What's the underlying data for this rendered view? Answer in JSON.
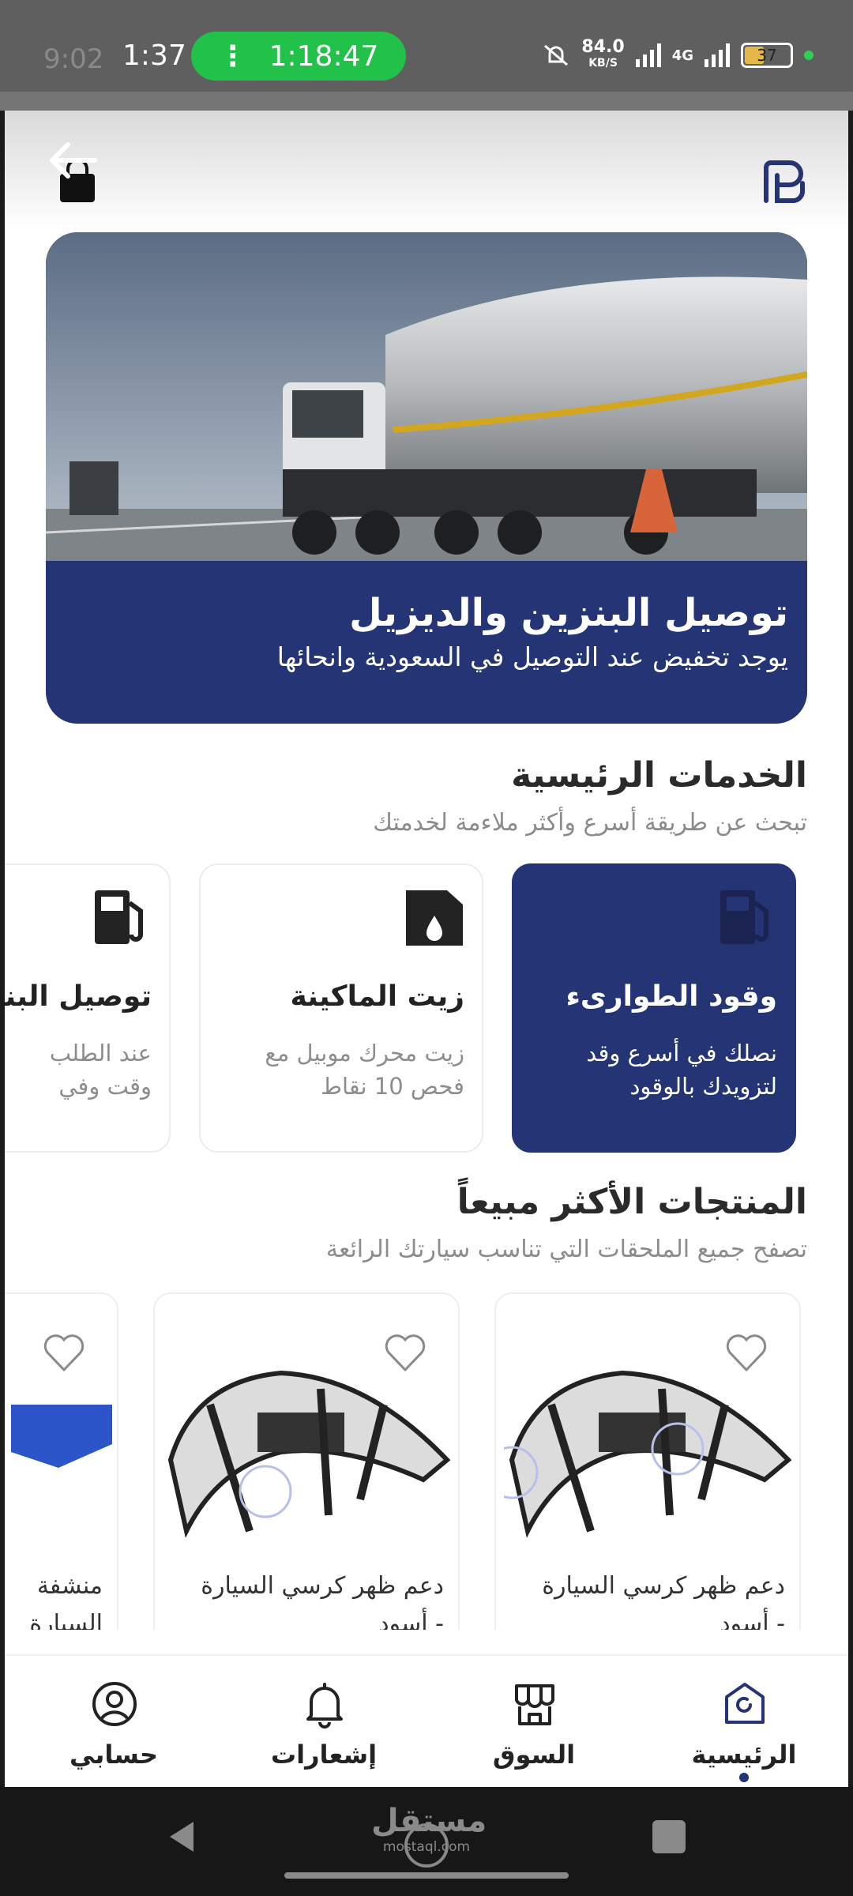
{
  "status_bar": {
    "ghost_time": "9:02",
    "time": "1:37",
    "call_dot": "⋮",
    "call_timer": "1:18:47",
    "net_speed": "84.0",
    "net_speed_unit": "KB/S",
    "network_type": "4G",
    "battery": "37"
  },
  "banner": {
    "title": "توصيل البنزين والديزيل",
    "subtitle": "يوجد تخفيض عند التوصيل في السعودية وانحائها"
  },
  "services_section": {
    "title": "الخدمات الرئيسية",
    "subtitle": "تبحث عن طريقة أسرع وأكثر ملاءمة لخدمتك",
    "items": [
      {
        "title": "وقود الطوارىء",
        "desc": "نصلك في أسرع وقد\nلتزويدك بالوقود",
        "icon": "fuel-pump-icon",
        "active": true
      },
      {
        "title": "زيت الماكينة",
        "desc": "زيت محرك موبيل مع\nفحص 10 نقاط",
        "icon": "oil-can-icon",
        "active": false
      },
      {
        "title": "توصيل البنزين",
        "desc": "عند الطلب\nوقت وفي",
        "icon": "fuel-pump-icon",
        "active": false
      }
    ]
  },
  "products_section": {
    "title": "المنتجات الأكثر مبيعاً",
    "subtitle": "تصفح جميع الملحقات التي تناسب سيارتك الرائعة",
    "items": [
      {
        "name": "دعم ظهر كرسي السيارة",
        "name2": "- أسود"
      },
      {
        "name": "دعم ظهر كرسي السيارة",
        "name2": "- أسود"
      },
      {
        "name": "منشفة",
        "name2": "السيارة"
      }
    ]
  },
  "bottom_nav": {
    "items": [
      {
        "label": "الرئيسية",
        "icon": "home-icon",
        "active": true
      },
      {
        "label": "السوق",
        "icon": "store-icon",
        "active": false
      },
      {
        "label": "إشعارات",
        "icon": "bell-icon",
        "active": false
      },
      {
        "label": "حسابي",
        "icon": "user-icon",
        "active": false
      }
    ]
  },
  "watermark": {
    "text": "مستقل",
    "sub": "mostaql.com"
  },
  "colors": {
    "primary": "#253474",
    "call_green": "#22c24a",
    "text_dark": "#222222",
    "text_muted": "#8c8c8c"
  }
}
